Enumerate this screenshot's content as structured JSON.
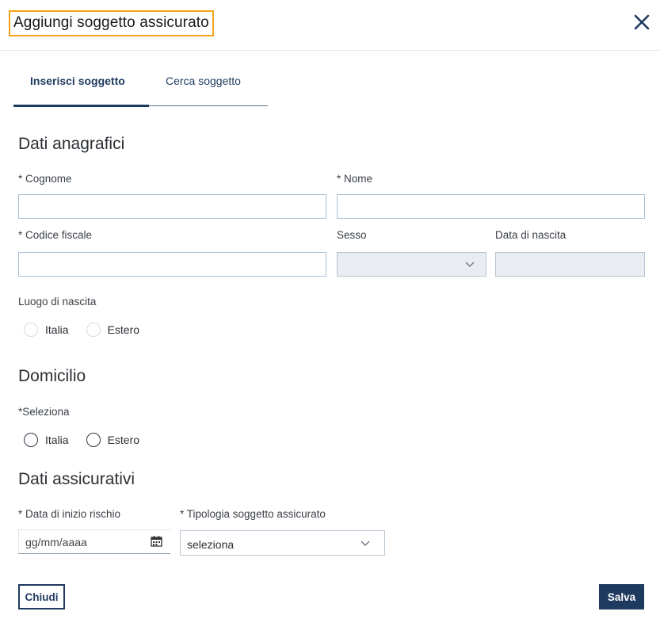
{
  "dialog": {
    "title": "Aggiungi soggetto assicurato",
    "close_icon": "close-icon"
  },
  "tabs": [
    {
      "label": "Inserisci soggetto",
      "active": true
    },
    {
      "label": "Cerca soggetto",
      "active": false
    }
  ],
  "anagrafici": {
    "heading": "Dati anagrafici",
    "cognome_label": "* Cognome",
    "cognome_value": "",
    "nome_label": "* Nome",
    "nome_value": "",
    "codice_fiscale_label": "* Codice fiscale",
    "codice_fiscale_value": "",
    "sesso_label": "Sesso",
    "sesso_value": "",
    "data_nascita_label": "Data di nascita",
    "data_nascita_value": "",
    "luogo_label": "Luogo di nascita",
    "luogo_options": [
      "Italia",
      "Estero"
    ]
  },
  "domicilio": {
    "heading": "Domicilio",
    "select_label": "*Seleziona",
    "options": [
      "Italia",
      "Estero"
    ]
  },
  "assicurativi": {
    "heading": "Dati assicurativi",
    "data_inizio_label": "* Data di inizio rischio",
    "data_inizio_placeholder": "gg/mm/aaaa",
    "tipologia_label": "* Tipologia soggetto assicurato",
    "tipologia_value": "seleziona"
  },
  "actions": {
    "close_label": "Chiudi",
    "save_label": "Salva"
  },
  "colors": {
    "primary": "#1f3a5f",
    "focus_outline": "#f5a31a",
    "input_border": "#a9c0d6",
    "disabled_bg": "#e9edf2"
  }
}
